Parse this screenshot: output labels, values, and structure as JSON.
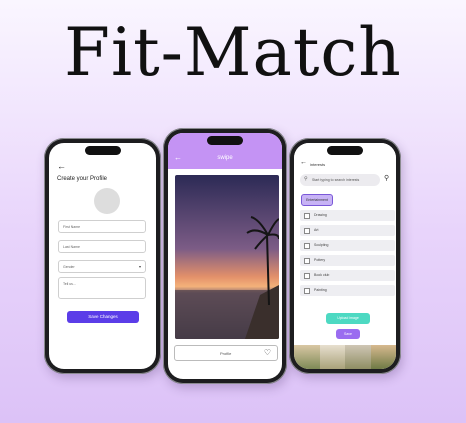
{
  "title": "Fit-Match",
  "profile": {
    "back_icon": "arrow-left-icon",
    "heading": "Create your Profile",
    "first_name": "First Name",
    "last_name": "Last Name",
    "gender": "Gender",
    "tell_us": "Tell us...",
    "save_label": "Save Changes"
  },
  "swipe": {
    "title": "swipe",
    "back_icon": "arrow-left-icon",
    "profile_label": "Profile",
    "heart_icon": "heart-icon"
  },
  "interests": {
    "title": "interests",
    "search_placeholder": "Start typing to search interests",
    "chip": "Entertainment",
    "items": [
      "Drawing",
      "Art",
      "Sculpting",
      "Pottery",
      "Book club",
      "Painting"
    ],
    "upload_label": "Upload image",
    "save_label": "Save"
  },
  "colors": {
    "accent_purple": "#c493f4",
    "button_blue": "#5b3de8",
    "teal": "#4dd9c2"
  }
}
